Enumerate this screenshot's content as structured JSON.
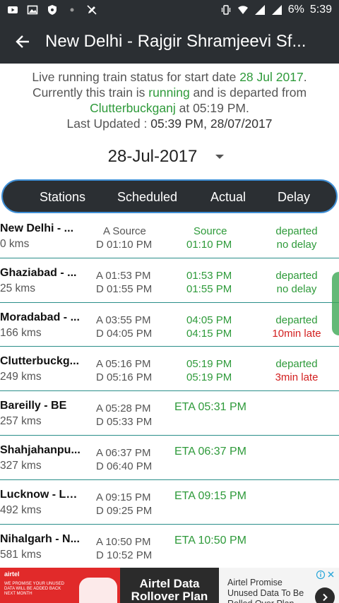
{
  "status_bar": {
    "left_icons": [
      "youtube-icon",
      "gallery-icon",
      "shield-icon",
      "notification-dot-icon",
      "pencil-off-icon"
    ],
    "right_icons": [
      "vibrate-icon",
      "wifi-icon",
      "signal-icon",
      "signal-icon"
    ],
    "battery": "6%",
    "time": "5:39"
  },
  "app_bar": {
    "title": "New Delhi - Rajgir Shramjeevi Sf..."
  },
  "info": {
    "line1_prefix": "Live running train status for start date ",
    "start_date": "28 Jul 2017",
    "line1_suffix": ".",
    "line2_prefix": "Currently this train is ",
    "state": "running",
    "line2_suffix": " and is departed from",
    "station": "Clutterbuckganj",
    "line3_suffix": " at 05:19 PM.",
    "line4_prefix": "Last Updated : ",
    "last_updated": "05:39 PM, 28/07/2017"
  },
  "date_selector": {
    "value": "28-Jul-2017"
  },
  "table": {
    "headers": [
      "Stations",
      "Scheduled",
      "Actual",
      "Delay"
    ],
    "rows": [
      {
        "name": "New Delhi - ...",
        "km": "0 kms",
        "sched_a": "A Source",
        "sched_d": "D 01:10 PM",
        "actual_a": "Source",
        "actual_d": "01:10 PM",
        "status": "departed",
        "delay": "no delay",
        "late": false
      },
      {
        "name": "Ghaziabad - ...",
        "km": "25 kms",
        "sched_a": "A 01:53 PM",
        "sched_d": "D 01:55 PM",
        "actual_a": "01:53 PM",
        "actual_d": "01:55 PM",
        "status": "departed",
        "delay": "no delay",
        "late": false
      },
      {
        "name": "Moradabad - ...",
        "km": "166 kms",
        "sched_a": "A 03:55 PM",
        "sched_d": "D 04:05 PM",
        "actual_a": "04:05 PM",
        "actual_d": "04:15 PM",
        "status": "departed",
        "delay": "10min  late",
        "late": true
      },
      {
        "name": "Clutterbuckg...",
        "km": "249 kms",
        "sched_a": "A 05:16 PM",
        "sched_d": "D 05:16 PM",
        "actual_a": "05:19 PM",
        "actual_d": "05:19 PM",
        "status": "departed",
        "delay": "3min  late",
        "late": true
      },
      {
        "name": "Bareilly - BE",
        "km": "257 kms",
        "sched_a": "A 05:28 PM",
        "sched_d": "D 05:33 PM",
        "eta": "ETA 05:31 PM"
      },
      {
        "name": "Shahjahanpu...",
        "km": "327 kms",
        "sched_a": "A 06:37 PM",
        "sched_d": "D 06:40 PM",
        "eta": "ETA 06:37 PM"
      },
      {
        "name": "Lucknow - LK...",
        "km": "492 kms",
        "sched_a": "A 09:15 PM",
        "sched_d": "D 09:25 PM",
        "eta": "ETA 09:15 PM"
      },
      {
        "name": "Nihalgarh - N...",
        "km": "581 kms",
        "sched_a": "A 10:50 PM",
        "sched_d": "D 10:52 PM",
        "eta": "ETA 10:50 PM"
      }
    ]
  },
  "ad": {
    "brand": "airtel",
    "promise_text": "WE PROMISE YOUR UNUSED DATA WILL BE ADDED BACK NEXT MONTH",
    "headline": "Airtel Data Rollover Plan",
    "body": "Airtel Promise Unused Data To Be Rolled Over Plan",
    "colors": {
      "red": "#e12a2a",
      "dark": "#2b2b2b"
    }
  },
  "colors": {
    "bar_bg": "#2b2f33",
    "accent_green": "#2e9a3a",
    "late_red": "#d21f1f",
    "divider_teal": "#2a8e8a",
    "header_border": "#3f8fd6"
  }
}
